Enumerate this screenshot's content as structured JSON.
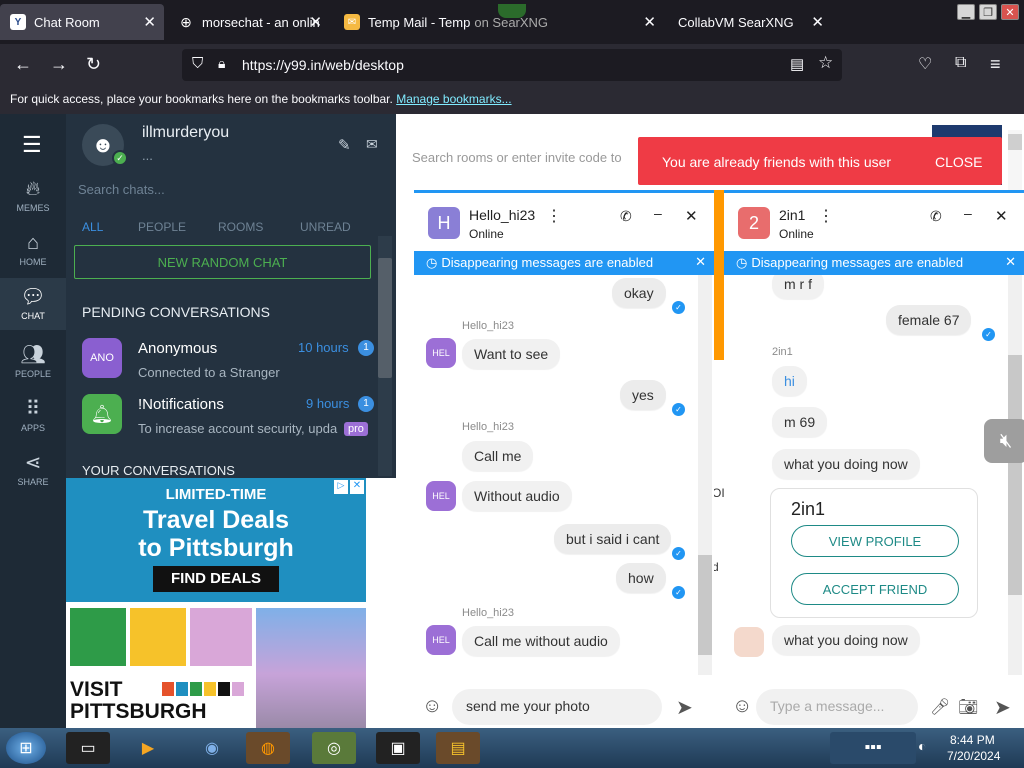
{
  "browser": {
    "tabs": [
      {
        "label": "Chat Room",
        "icon": "y99-favicon"
      },
      {
        "label": "morsechat - an onlin",
        "icon": "globe-icon"
      },
      {
        "label": "Temp Mail - Temp",
        "icon": "tempmail-favicon"
      },
      {
        "label": "CollabVM SearXNG",
        "icon": "none"
      }
    ],
    "tab3_extra": "on SearXNG",
    "url": "https://y99.in/web/desktop",
    "bookmarks_text": "For quick access, place your bookmarks here on the bookmarks toolbar.",
    "bookmarks_link": "Manage bookmarks..."
  },
  "rail": [
    {
      "label": "MEMES",
      "icon": "flame-icon"
    },
    {
      "label": "HOME",
      "icon": "home-icon"
    },
    {
      "label": "CHAT",
      "icon": "chat-icon"
    },
    {
      "label": "PEOPLE",
      "icon": "people-icon"
    },
    {
      "label": "APPS",
      "icon": "apps-grid-icon"
    },
    {
      "label": "SHARE",
      "icon": "share-icon"
    }
  ],
  "profile": {
    "username": "illmurderyou",
    "status": "..."
  },
  "search_placeholder": "Search chats...",
  "filters": [
    "ALL",
    "PEOPLE",
    "ROOMS",
    "UNREAD"
  ],
  "new_random_chat": "NEW RANDOM CHAT",
  "pending_header": "PENDING CONVERSATIONS",
  "pending": [
    {
      "avatar": "ANO",
      "name": "Anonymous",
      "time": "10 hours",
      "count": "1",
      "preview": "Connected to a Stranger"
    },
    {
      "avatar": "",
      "name": "!Notifications",
      "time": "9 hours",
      "count": "1",
      "preview": "To increase account security, upda",
      "badge": "pro"
    }
  ],
  "your_conversations": "YOUR CONVERSATIONS",
  "ad": {
    "line1": "LIMITED-TIME",
    "line2": "Travel Deals",
    "line3": "to Pittsburgh",
    "cta": "FIND DEALS",
    "brand1": "VISIT",
    "brand2": "PITTSBURGH"
  },
  "room_search_placeholder": "Search rooms or enter invite code to",
  "toast": {
    "text": "You are already friends with this user",
    "action": "CLOSE"
  },
  "colors": {
    "accent": "#2196f3",
    "toast": "#ef3b45",
    "green": "#4caf50",
    "purple": "#9c6fd6"
  },
  "chat1": {
    "avatar": "H",
    "name": "Hello_hi23",
    "status": "Online",
    "banner": "Disappearing messages are enabled",
    "messages": [
      {
        "text": "okay",
        "me": true
      },
      {
        "sender": "Hello_hi23",
        "text": "Want to see",
        "me": false
      },
      {
        "text": "yes",
        "me": true
      },
      {
        "sender": "Hello_hi23",
        "text": "Call me",
        "me": false
      },
      {
        "text": "Without audio",
        "me": false
      },
      {
        "text": "but i said i cant",
        "me": true
      },
      {
        "text": "how",
        "me": true
      },
      {
        "sender": "Hello_hi23",
        "text": "Call me without audio",
        "me": false
      }
    ],
    "avatar_label": "HEL",
    "input_value": "send me your photo"
  },
  "chat2": {
    "avatar": "2",
    "name": "2in1",
    "status": "Online",
    "banner": "Disappearing messages are enabled",
    "messages": [
      {
        "text": "m r f",
        "me": false
      },
      {
        "text": "female 67",
        "me": true
      },
      {
        "sender": "2in1",
        "text": "hi",
        "me": false
      },
      {
        "text": "m 69",
        "me": false
      },
      {
        "text": "what you doing now",
        "me": false
      },
      {
        "text": "what you doing now",
        "me": false
      }
    ],
    "card": {
      "name": "2in1",
      "view": "VIEW PROFILE",
      "accept": "ACCEPT FRIEND"
    },
    "input_placeholder": "Type a message..."
  },
  "partial_chars": {
    "a": "OI",
    "b": "d"
  },
  "clock": {
    "time": "8:44 PM",
    "date": "7/20/2024"
  }
}
